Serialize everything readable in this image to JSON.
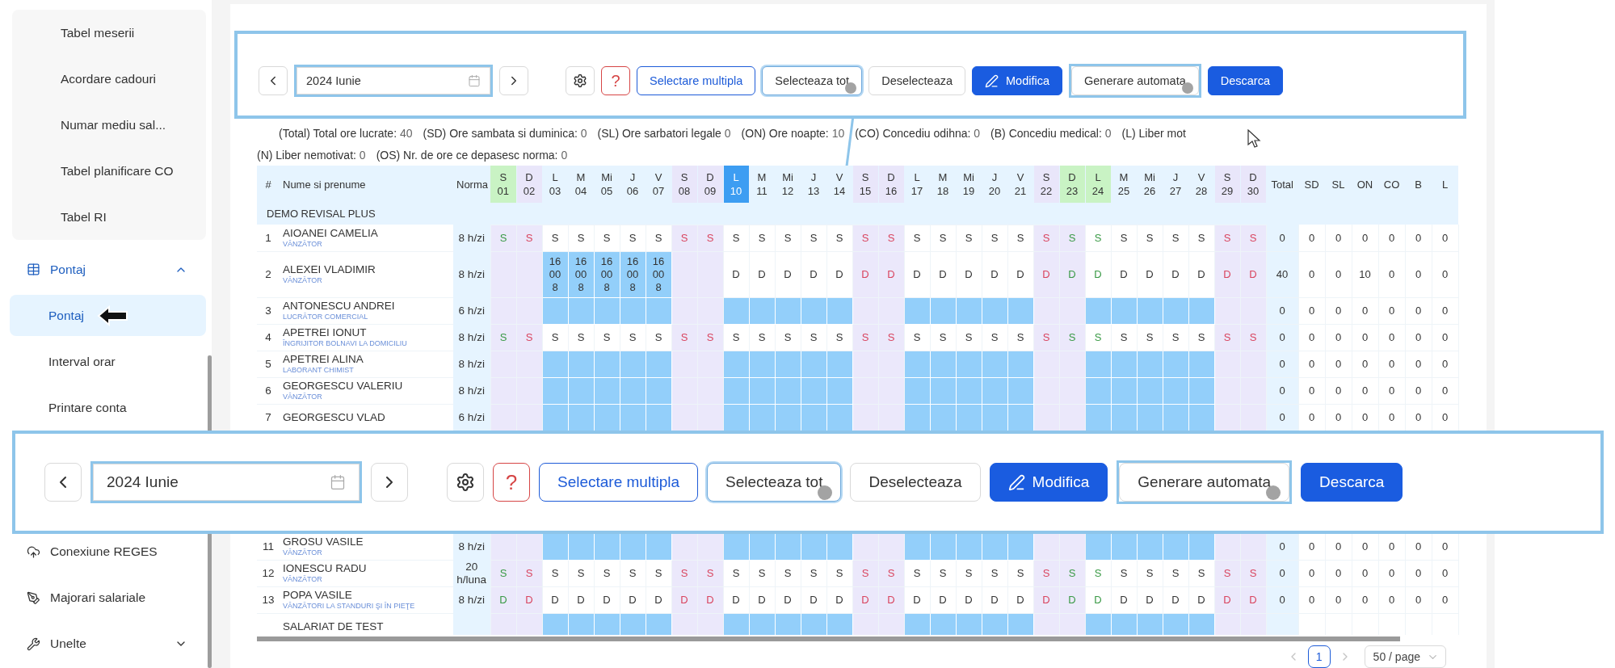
{
  "sidebar": {
    "top_items": [
      {
        "label": "Tabel meserii",
        "selected": false
      },
      {
        "label": "Acordare cadouri",
        "selected": false
      },
      {
        "label": "Numar mediu sal...",
        "selected": false
      },
      {
        "label": "Tabel planificare CO",
        "selected": false
      },
      {
        "label": "Tabel RI",
        "selected": false
      }
    ],
    "groups": [
      {
        "label": "Pontaj",
        "expanded": true,
        "children": [
          {
            "label": "Pontaj",
            "selected": true,
            "pointer": true
          },
          {
            "label": "Interval orar",
            "selected": false,
            "pointer": false
          },
          {
            "label": "Printare conta",
            "selected": false,
            "pointer": false
          }
        ]
      }
    ],
    "items_below_callout": [
      {
        "label": "Conexiune REGES"
      },
      {
        "label": "Majorari salariale"
      },
      {
        "label": "Unelte",
        "expanded": false
      }
    ]
  },
  "toolbar": {
    "highlighted": true,
    "items": [
      {
        "kind": "prev"
      },
      {
        "kind": "date",
        "value": "2024 Iunie",
        "highlighted": true
      },
      {
        "kind": "next"
      },
      {
        "kind": "settings"
      },
      {
        "kind": "help",
        "label": "?"
      },
      {
        "kind": "outline-button",
        "label": "Selectare multipla"
      },
      {
        "kind": "button",
        "label": "Selecteaza tot",
        "focused": true,
        "click_marker": true
      },
      {
        "kind": "button",
        "label": "Deselecteaza"
      },
      {
        "kind": "edit-button",
        "label": "Modifica"
      },
      {
        "kind": "button",
        "label": "Generare automata",
        "highlighted": true,
        "click_marker": true
      },
      {
        "kind": "primary-button",
        "label": "Descarca"
      }
    ]
  },
  "legend": [
    {
      "items": [
        {
          "label": "(Total) Total ore lucrate:",
          "value": "40"
        },
        {
          "label": "(SD) Ore sambata si duminica:",
          "value": "0"
        },
        {
          "label": "(SL) Ore sarbatori legale",
          "value": "0"
        },
        {
          "label": "(ON) Ore noapte:",
          "value": "10"
        },
        {
          "label": "(CO) Concediu odihna:",
          "value": "0"
        },
        {
          "label": "(B) Concediu medical:",
          "value": "0"
        },
        {
          "label": "(L) Liber mot"
        }
      ]
    },
    {
      "items": [
        {
          "label": "(N) Liber nemotivat:",
          "value": "0"
        },
        {
          "label": "(OS) Nr. de ore ce depasesc norma:",
          "value": "0"
        }
      ]
    }
  ],
  "table": {
    "columns": {
      "index": "#",
      "name": "Nume si prenume",
      "norm": "Norma"
    },
    "days": [
      {
        "letter": "S",
        "number": "01",
        "weekend": true,
        "holiday": true,
        "selected": false
      },
      {
        "letter": "D",
        "number": "02",
        "weekend": true,
        "holiday": false,
        "selected": false
      },
      {
        "letter": "L",
        "number": "03",
        "weekend": false,
        "holiday": false,
        "selected": false
      },
      {
        "letter": "M",
        "number": "04",
        "weekend": false,
        "holiday": false,
        "selected": false
      },
      {
        "letter": "Mi",
        "number": "05",
        "weekend": false,
        "holiday": false,
        "selected": false
      },
      {
        "letter": "J",
        "number": "06",
        "weekend": false,
        "holiday": false,
        "selected": false
      },
      {
        "letter": "V",
        "number": "07",
        "weekend": false,
        "holiday": false,
        "selected": false
      },
      {
        "letter": "S",
        "number": "08",
        "weekend": true,
        "holiday": false,
        "selected": false
      },
      {
        "letter": "D",
        "number": "09",
        "weekend": true,
        "holiday": false,
        "selected": false
      },
      {
        "letter": "L",
        "number": "10",
        "weekend": false,
        "holiday": false,
        "selected": true
      },
      {
        "letter": "M",
        "number": "11",
        "weekend": false,
        "holiday": false,
        "selected": false
      },
      {
        "letter": "Mi",
        "number": "12",
        "weekend": false,
        "holiday": false,
        "selected": false
      },
      {
        "letter": "J",
        "number": "13",
        "weekend": false,
        "holiday": false,
        "selected": false
      },
      {
        "letter": "V",
        "number": "14",
        "weekend": false,
        "holiday": false,
        "selected": false
      },
      {
        "letter": "S",
        "number": "15",
        "weekend": true,
        "holiday": false,
        "selected": false
      },
      {
        "letter": "D",
        "number": "16",
        "weekend": true,
        "holiday": false,
        "selected": false
      },
      {
        "letter": "L",
        "number": "17",
        "weekend": false,
        "holiday": false,
        "selected": false
      },
      {
        "letter": "M",
        "number": "18",
        "weekend": false,
        "holiday": false,
        "selected": false
      },
      {
        "letter": "Mi",
        "number": "19",
        "weekend": false,
        "holiday": false,
        "selected": false
      },
      {
        "letter": "J",
        "number": "20",
        "weekend": false,
        "holiday": false,
        "selected": false
      },
      {
        "letter": "V",
        "number": "21",
        "weekend": false,
        "holiday": false,
        "selected": false
      },
      {
        "letter": "S",
        "number": "22",
        "weekend": true,
        "holiday": false,
        "selected": false
      },
      {
        "letter": "D",
        "number": "23",
        "weekend": true,
        "holiday": true,
        "selected": false
      },
      {
        "letter": "L",
        "number": "24",
        "weekend": false,
        "holiday": true,
        "selected": false
      },
      {
        "letter": "M",
        "number": "25",
        "weekend": false,
        "holiday": false,
        "selected": false
      },
      {
        "letter": "Mi",
        "number": "26",
        "weekend": false,
        "holiday": false,
        "selected": false
      },
      {
        "letter": "J",
        "number": "27",
        "weekend": false,
        "holiday": false,
        "selected": false
      },
      {
        "letter": "V",
        "number": "28",
        "weekend": false,
        "holiday": false,
        "selected": false
      },
      {
        "letter": "S",
        "number": "29",
        "weekend": true,
        "holiday": false,
        "selected": false
      },
      {
        "letter": "D",
        "number": "30",
        "weekend": true,
        "holiday": false,
        "selected": false
      }
    ],
    "totals_columns": [
      "Total",
      "SD",
      "SL",
      "ON",
      "CO",
      "B",
      "L"
    ],
    "group": "DEMO REVISAL PLUS",
    "rows": [
      {
        "index": "1",
        "name": "AIOANEI CAMELIA",
        "job": "VÂNZĂTOR",
        "norm": "8 h/zi",
        "cells": [
          "S",
          "S",
          "S",
          "S",
          "S",
          "S",
          "S",
          "S",
          "S",
          "S",
          "S",
          "S",
          "S",
          "S",
          "S",
          "S",
          "S",
          "S",
          "S",
          "S",
          "S",
          "S",
          "S",
          "S",
          "S",
          "S",
          "S",
          "S",
          "S",
          "S"
        ],
        "highlighted": [
          false,
          false,
          false,
          false,
          false,
          false,
          false,
          false,
          false,
          false,
          false,
          false,
          false,
          false,
          false,
          false,
          false,
          false,
          false,
          false,
          false,
          false,
          false,
          false,
          false,
          false,
          false,
          false,
          false,
          false
        ],
        "totals": [
          "0",
          "0",
          "0",
          "0",
          "0",
          "0",
          "0"
        ]
      },
      {
        "index": "2",
        "name": "ALEXEI VLADIMIR",
        "job": "VÂNZĂTOR",
        "norm": "8 h/zi",
        "cells": [
          null,
          null,
          "16\n00\n8",
          "16\n00\n8",
          "16\n00\n8",
          "16\n00\n8",
          "16\n00\n8",
          null,
          null,
          "D",
          "D",
          "D",
          "D",
          "D",
          "D",
          "D",
          "D",
          "D",
          "D",
          "D",
          "D",
          "D",
          "D",
          "D",
          "D",
          "D",
          "D",
          "D",
          "D",
          "D"
        ],
        "highlighted": [
          false,
          false,
          true,
          true,
          true,
          true,
          true,
          false,
          false,
          false,
          false,
          false,
          false,
          false,
          false,
          false,
          false,
          false,
          false,
          false,
          false,
          false,
          false,
          false,
          false,
          false,
          false,
          false,
          false,
          false
        ],
        "totals": [
          "40",
          "0",
          "0",
          "10",
          "0",
          "0",
          "0"
        ]
      },
      {
        "index": "3",
        "name": "ANTONESCU ANDREI",
        "job": "LUCRĂTOR COMERCIAL",
        "norm": "6 h/zi",
        "cells": [
          null,
          null,
          null,
          null,
          null,
          null,
          null,
          null,
          null,
          null,
          null,
          null,
          null,
          null,
          null,
          null,
          null,
          null,
          null,
          null,
          null,
          null,
          null,
          null,
          null,
          null,
          null,
          null,
          null,
          null
        ],
        "highlighted": [
          false,
          false,
          true,
          true,
          true,
          true,
          true,
          false,
          false,
          true,
          true,
          true,
          true,
          true,
          false,
          false,
          true,
          true,
          true,
          true,
          true,
          false,
          false,
          true,
          true,
          true,
          true,
          true,
          false,
          false
        ],
        "totals": [
          "0",
          "0",
          "0",
          "0",
          "0",
          "0",
          "0"
        ]
      },
      {
        "index": "4",
        "name": "APETREI IONUT",
        "job": "ÎNGRIJITOR BOLNAVI LA DOMICILIU",
        "norm": "8 h/zi",
        "cells": [
          "S",
          "S",
          "S",
          "S",
          "S",
          "S",
          "S",
          "S",
          "S",
          "S",
          "S",
          "S",
          "S",
          "S",
          "S",
          "S",
          "S",
          "S",
          "S",
          "S",
          "S",
          "S",
          "S",
          "S",
          "S",
          "S",
          "S",
          "S",
          "S",
          "S"
        ],
        "highlighted": [
          false,
          false,
          false,
          false,
          false,
          false,
          false,
          false,
          false,
          false,
          false,
          false,
          false,
          false,
          false,
          false,
          false,
          false,
          false,
          false,
          false,
          false,
          false,
          false,
          false,
          false,
          false,
          false,
          false,
          false
        ],
        "totals": [
          "0",
          "0",
          "0",
          "0",
          "0",
          "0",
          "0"
        ]
      },
      {
        "index": "5",
        "name": "APETREI ALINA",
        "job": "LABORANT CHIMIST",
        "norm": "8 h/zi",
        "cells": [
          null,
          null,
          null,
          null,
          null,
          null,
          null,
          null,
          null,
          null,
          null,
          null,
          null,
          null,
          null,
          null,
          null,
          null,
          null,
          null,
          null,
          null,
          null,
          null,
          null,
          null,
          null,
          null,
          null,
          null
        ],
        "highlighted": [
          false,
          false,
          true,
          true,
          true,
          true,
          true,
          false,
          false,
          true,
          true,
          true,
          true,
          true,
          false,
          false,
          true,
          true,
          true,
          true,
          true,
          false,
          false,
          true,
          true,
          true,
          true,
          true,
          false,
          false
        ],
        "totals": [
          "0",
          "0",
          "0",
          "0",
          "0",
          "0",
          "0"
        ]
      },
      {
        "index": "6",
        "name": "GEORGESCU VALERIU",
        "job": "VÂNZĂTOR",
        "norm": "8 h/zi",
        "cells": [
          null,
          null,
          null,
          null,
          null,
          null,
          null,
          null,
          null,
          null,
          null,
          null,
          null,
          null,
          null,
          null,
          null,
          null,
          null,
          null,
          null,
          null,
          null,
          null,
          null,
          null,
          null,
          null,
          null,
          null
        ],
        "highlighted": [
          false,
          false,
          true,
          true,
          true,
          true,
          true,
          false,
          false,
          true,
          true,
          true,
          true,
          true,
          false,
          false,
          true,
          true,
          true,
          true,
          true,
          false,
          false,
          true,
          true,
          true,
          true,
          true,
          false,
          false
        ],
        "totals": [
          "0",
          "0",
          "0",
          "0",
          "0",
          "0",
          "0"
        ]
      },
      {
        "index": "7",
        "name": "GEORGESCU VLAD",
        "norm": "6 h/zi",
        "cells": [
          null,
          null,
          null,
          null,
          null,
          null,
          null,
          null,
          null,
          null,
          null,
          null,
          null,
          null,
          null,
          null,
          null,
          null,
          null,
          null,
          null,
          null,
          null,
          null,
          null,
          null,
          null,
          null,
          null,
          null
        ],
        "highlighted": [
          false,
          false,
          true,
          true,
          true,
          true,
          true,
          false,
          false,
          true,
          true,
          true,
          true,
          true,
          false,
          false,
          true,
          true,
          true,
          true,
          true,
          false,
          false,
          true,
          true,
          true,
          true,
          true,
          false,
          false
        ],
        "totals": [
          "0",
          "0",
          "0",
          "0",
          "0",
          "0",
          "0"
        ]
      }
    ],
    "rows_below_callout": [
      {
        "index": "11",
        "name": "GROSU VASILE",
        "job": "VÂNZĂTOR",
        "norm": "8 h/zi",
        "cells": [
          null,
          null,
          null,
          null,
          null,
          null,
          null,
          null,
          null,
          null,
          null,
          null,
          null,
          null,
          null,
          null,
          null,
          null,
          null,
          null,
          null,
          null,
          null,
          null,
          null,
          null,
          null,
          null,
          null,
          null
        ],
        "highlighted": [
          false,
          false,
          true,
          true,
          true,
          true,
          true,
          false,
          false,
          true,
          true,
          true,
          true,
          true,
          false,
          false,
          true,
          true,
          true,
          true,
          true,
          false,
          false,
          true,
          true,
          true,
          true,
          true,
          false,
          false
        ],
        "totals": [
          "0",
          "0",
          "0",
          "0",
          "0",
          "0",
          "0"
        ]
      },
      {
        "index": "12",
        "name": "IONESCU RADU",
        "job": "VÂNZĂTOR",
        "norm": "20 h/luna",
        "cells": [
          "S",
          "S",
          "S",
          "S",
          "S",
          "S",
          "S",
          "S",
          "S",
          "S",
          "S",
          "S",
          "S",
          "S",
          "S",
          "S",
          "S",
          "S",
          "S",
          "S",
          "S",
          "S",
          "S",
          "S",
          "S",
          "S",
          "S",
          "S",
          "S",
          "S"
        ],
        "highlighted": [
          false,
          false,
          false,
          false,
          false,
          false,
          false,
          false,
          false,
          false,
          false,
          false,
          false,
          false,
          false,
          false,
          false,
          false,
          false,
          false,
          false,
          false,
          false,
          false,
          false,
          false,
          false,
          false,
          false,
          false
        ],
        "totals": [
          "0",
          "0",
          "0",
          "0",
          "0",
          "0",
          "0"
        ]
      },
      {
        "index": "13",
        "name": "POPA VASILE",
        "job": "VÂNZĂTORI LA STANDURI ŞI ÎN PIEŢE",
        "norm": "8 h/zi",
        "cells": [
          "D",
          "D",
          "D",
          "D",
          "D",
          "D",
          "D",
          "D",
          "D",
          "D",
          "D",
          "D",
          "D",
          "D",
          "D",
          "D",
          "D",
          "D",
          "D",
          "D",
          "D",
          "D",
          "D",
          "D",
          "D",
          "D",
          "D",
          "D",
          "D",
          "D"
        ],
        "highlighted": [
          false,
          false,
          false,
          false,
          false,
          false,
          false,
          false,
          false,
          false,
          false,
          false,
          false,
          false,
          false,
          false,
          false,
          false,
          false,
          false,
          false,
          false,
          false,
          false,
          false,
          false,
          false,
          false,
          false,
          false
        ],
        "totals": [
          "0",
          "0",
          "0",
          "0",
          "0",
          "0",
          "0"
        ]
      },
      {
        "name": "SALARIAT DE TEST",
        "cells": [
          null,
          null,
          null,
          null,
          null,
          null,
          null,
          null,
          null,
          null,
          null,
          null,
          null,
          null,
          null,
          null,
          null,
          null,
          null,
          null,
          null,
          null,
          null,
          null,
          null,
          null,
          null,
          null,
          null,
          null
        ],
        "highlighted": [
          false,
          false,
          true,
          true,
          true,
          true,
          true,
          false,
          false,
          true,
          true,
          true,
          true,
          true,
          false,
          false,
          true,
          true,
          true,
          true,
          true,
          false,
          false,
          true,
          true,
          true,
          true,
          true,
          false,
          false
        ]
      }
    ]
  },
  "pagination": {
    "prev": {
      "disabled": true
    },
    "pages": [
      {
        "label": "1",
        "selected": true
      }
    ],
    "next": {
      "disabled": true
    },
    "page_size": "50 / page"
  },
  "callout": {
    "items": [
      {
        "kind": "prev"
      },
      {
        "kind": "date",
        "value": "2024 Iunie",
        "highlighted": true
      },
      {
        "kind": "next"
      },
      {
        "kind": "settings"
      },
      {
        "kind": "help",
        "label": "?"
      },
      {
        "kind": "outline-button",
        "label": "Selectare multipla"
      },
      {
        "kind": "button",
        "label": "Selecteaza tot",
        "focused": true,
        "click_marker": true
      },
      {
        "kind": "button",
        "label": "Deselecteaza"
      },
      {
        "kind": "edit-button",
        "label": "Modifica"
      },
      {
        "kind": "button",
        "label": "Generare automata",
        "highlighted": true,
        "click_marker": true
      },
      {
        "kind": "primary-button",
        "label": "Descarca"
      }
    ]
  }
}
